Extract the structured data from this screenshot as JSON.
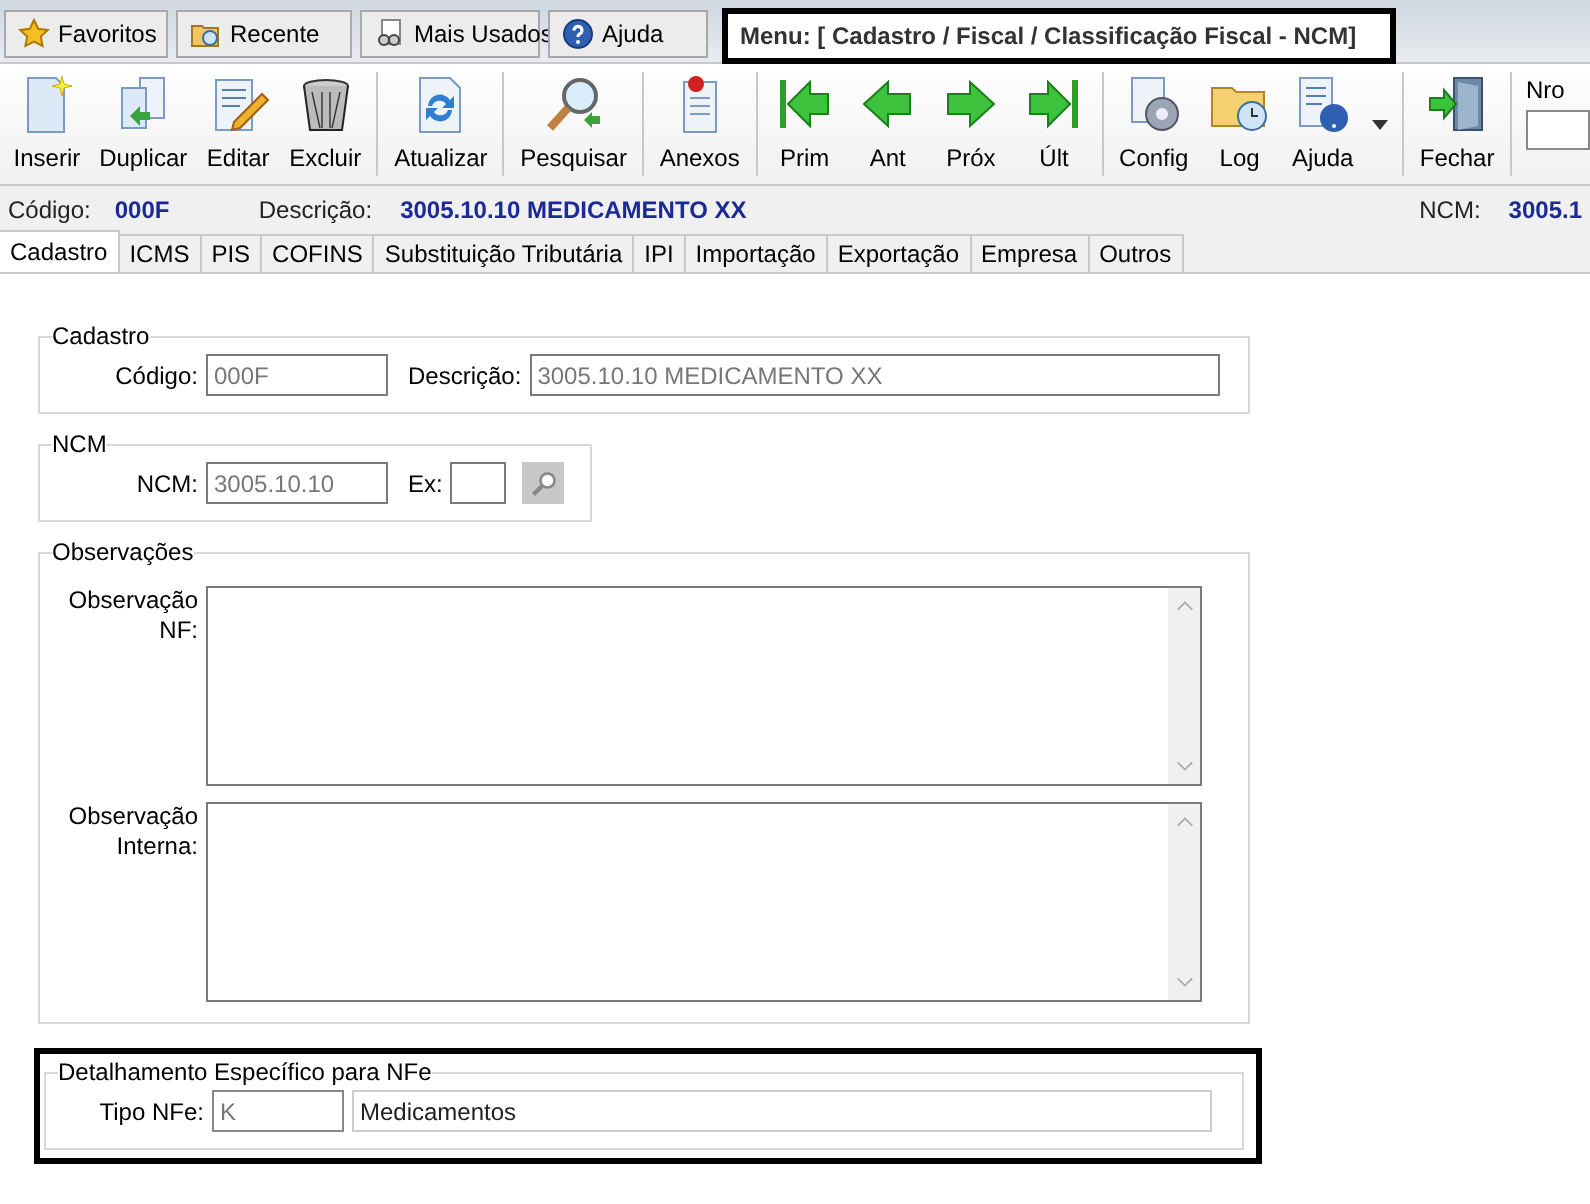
{
  "top_tabs": [
    {
      "label": "Favoritos"
    },
    {
      "label": "Recente"
    },
    {
      "label": "Mais Usados"
    },
    {
      "label": "Ajuda"
    }
  ],
  "menu_path": {
    "text": "Menu: [ Cadastro / Fiscal / Classificação Fiscal - NCM]",
    "highlighted": true
  },
  "toolbar": [
    {
      "label": "Inserir"
    },
    {
      "label": "Duplicar"
    },
    {
      "label": "Editar"
    },
    {
      "label": "Excluir"
    },
    {
      "label": "Atualizar"
    },
    {
      "label": "Pesquisar"
    },
    {
      "label": "Anexos"
    },
    {
      "label": "Prim"
    },
    {
      "label": "Ant"
    },
    {
      "label": "Próx"
    },
    {
      "label": "Últ"
    },
    {
      "label": "Config"
    },
    {
      "label": "Log"
    },
    {
      "label": "Ajuda"
    },
    {
      "label": "Fechar"
    }
  ],
  "nro": {
    "label": "Nro"
  },
  "info": {
    "codigo_label": "Código:",
    "codigo": "000F",
    "descricao_label": "Descrição:",
    "descricao": "3005.10.10 MEDICAMENTO XX",
    "ncm_label": "NCM:",
    "ncm": "3005.1"
  },
  "tabs": [
    {
      "label": "Cadastro",
      "selected": true
    },
    {
      "label": "ICMS",
      "selected": false
    },
    {
      "label": "PIS",
      "selected": false
    },
    {
      "label": "COFINS",
      "selected": false
    },
    {
      "label": "Substituição Tributária",
      "selected": false
    },
    {
      "label": "IPI",
      "selected": false
    },
    {
      "label": "Importação",
      "selected": false
    },
    {
      "label": "Exportação",
      "selected": false
    },
    {
      "label": "Empresa",
      "selected": false
    },
    {
      "label": "Outros",
      "selected": false
    }
  ],
  "cadastro": {
    "title": "Cadastro",
    "codigo_label": "Código:",
    "codigo": "000F",
    "descricao_label": "Descrição:",
    "descricao": "3005.10.10 MEDICAMENTO XX"
  },
  "ncm": {
    "title": "NCM",
    "ncm_label": "NCM:",
    "ncm": "3005.10.10",
    "ex_label": "Ex:"
  },
  "observacoes": {
    "title": "Observações",
    "fields": [
      {
        "label": "Observação NF:"
      },
      {
        "label": "Observação Interna:"
      }
    ]
  },
  "nfe": {
    "title": "Detalhamento Específico para NFe",
    "highlighted": true,
    "tipo_label": "Tipo NFe:",
    "tipo_code": "K",
    "tipo_desc": "Medicamentos"
  }
}
